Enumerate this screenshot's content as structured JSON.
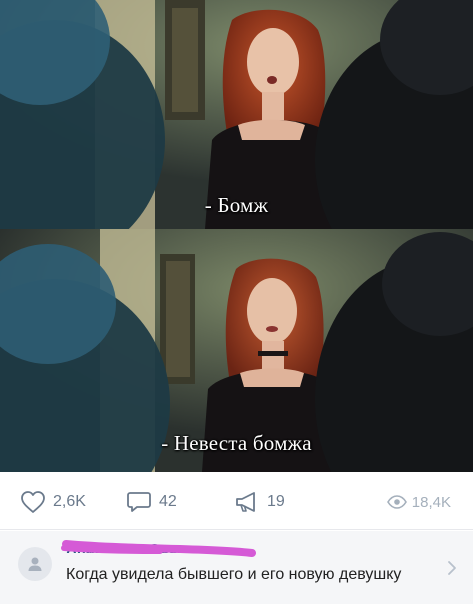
{
  "frames": [
    {
      "subtitle": "- Бомж"
    },
    {
      "subtitle": "- Невеста бомжа"
    }
  ],
  "post_actions": {
    "likes": "2,6K",
    "comments": "42",
    "shares": "19",
    "views": "18,4K"
  },
  "comment": {
    "author": "Анастасия Осоли...",
    "text": "Когда увидела бывшего и его новую девушку"
  },
  "colors": {
    "action_icon": "#6b7a8c",
    "views": "#a5b0bc",
    "scribble": "#d55ad6",
    "comment_bg": "#f5f6f8"
  },
  "icons": [
    "heart-icon",
    "comment-bubble-icon",
    "megaphone-icon",
    "eye-icon",
    "user-placeholder-icon",
    "chevron-right-icon"
  ]
}
